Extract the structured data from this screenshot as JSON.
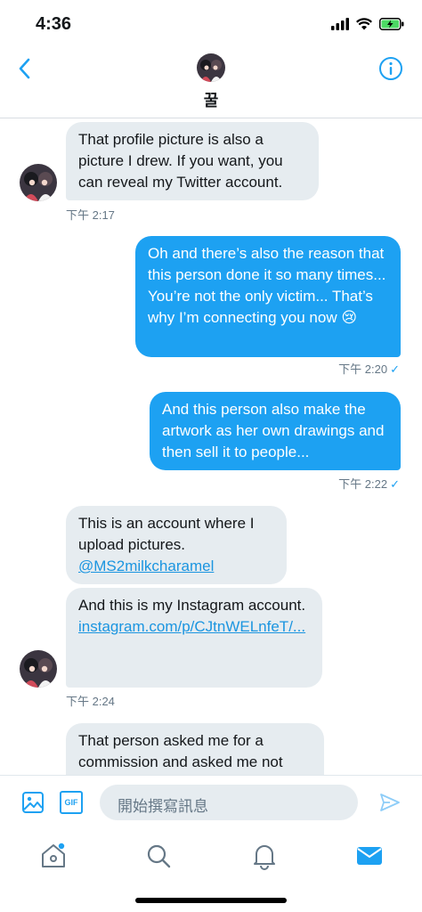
{
  "status_bar": {
    "time": "4:36"
  },
  "header": {
    "name": "꿀",
    "back_icon": "chevron-left-icon",
    "info_icon": "info-icon"
  },
  "messages": [
    {
      "side": "in",
      "text": "That profile picture is also a picture I drew. If you want, you can reveal my Twitter account."
    },
    {
      "side": "out",
      "text": "Oh and there’s also the reason that this person done it so many times... You’re not the only victim... That’s why I’m connecting you now 😢"
    },
    {
      "side": "out",
      "text": "And this person also make the artwork as her own drawings and then sell it to people..."
    },
    {
      "side": "in",
      "text": "This is an account where I upload pictures.",
      "link": "@MS2milkcharamel"
    },
    {
      "side": "in",
      "text": "And this is my Instagram account.",
      "link": "instagram.com/p/CJtnWELnfeT/..."
    },
    {
      "side": "in",
      "text": "That person asked me for a commission and asked me not"
    }
  ],
  "timestamps": [
    "下午 2:17",
    "下午 2:20",
    "下午 2:22",
    "下午 2:24"
  ],
  "composer": {
    "placeholder": "開始撰寫訊息",
    "gif_label": "GIF"
  },
  "tabs": [
    "home-icon",
    "search-icon",
    "notifications-icon",
    "messages-icon"
  ],
  "colors": {
    "accent": "#1da1f2",
    "incoming_bubble": "#e6ecf0",
    "timestamp": "#657786"
  }
}
